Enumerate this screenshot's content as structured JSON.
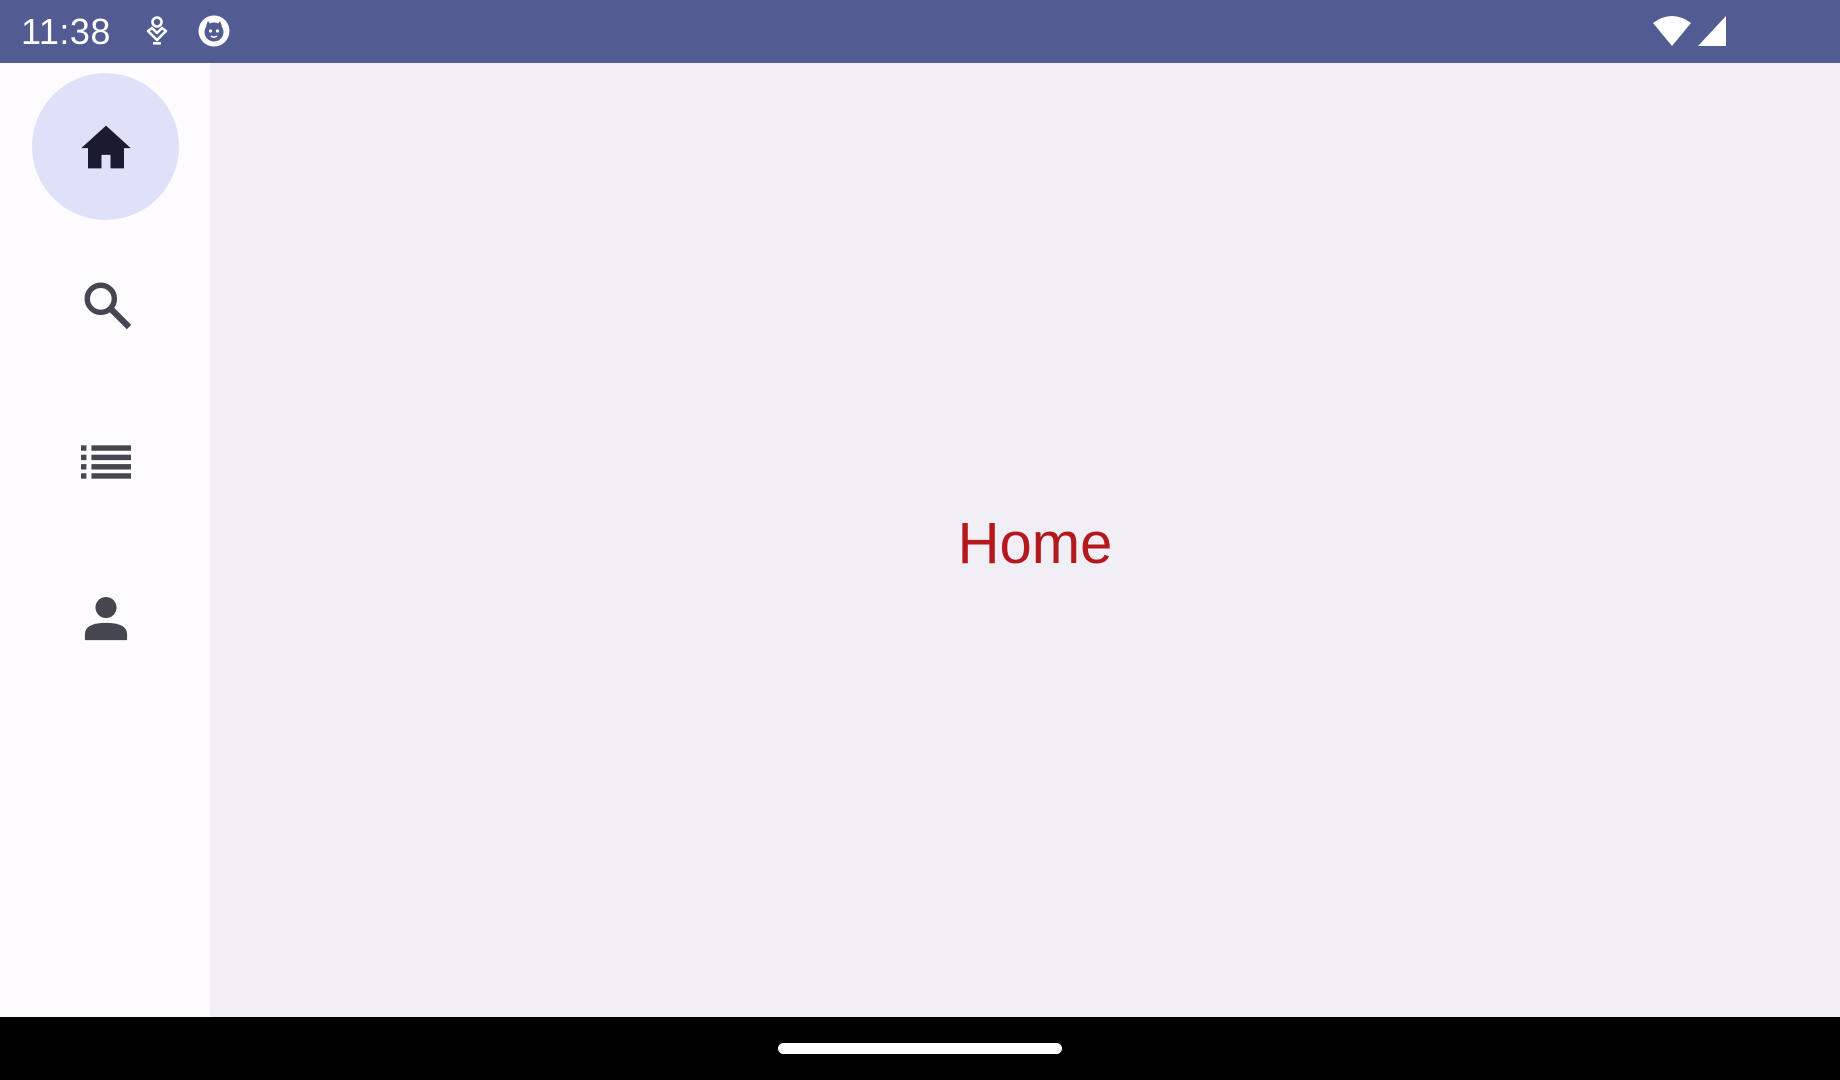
{
  "status_bar": {
    "time": "11:38",
    "notification_icons": [
      "tracker-icon",
      "app-face-icon"
    ],
    "system_icons": [
      "wifi-icon",
      "cellular-signal-icon"
    ],
    "background_color": "#525c93"
  },
  "nav_rail": {
    "items": [
      {
        "id": "home",
        "icon": "home-icon",
        "selected": true
      },
      {
        "id": "search",
        "icon": "search-icon",
        "selected": false
      },
      {
        "id": "list",
        "icon": "list-icon",
        "selected": false
      },
      {
        "id": "profile",
        "icon": "person-icon",
        "selected": false
      }
    ],
    "active_indicator_color": "#dfe1f9"
  },
  "main": {
    "title": "Home",
    "title_color": "#b3191c",
    "background_color": "#f1eff5"
  }
}
